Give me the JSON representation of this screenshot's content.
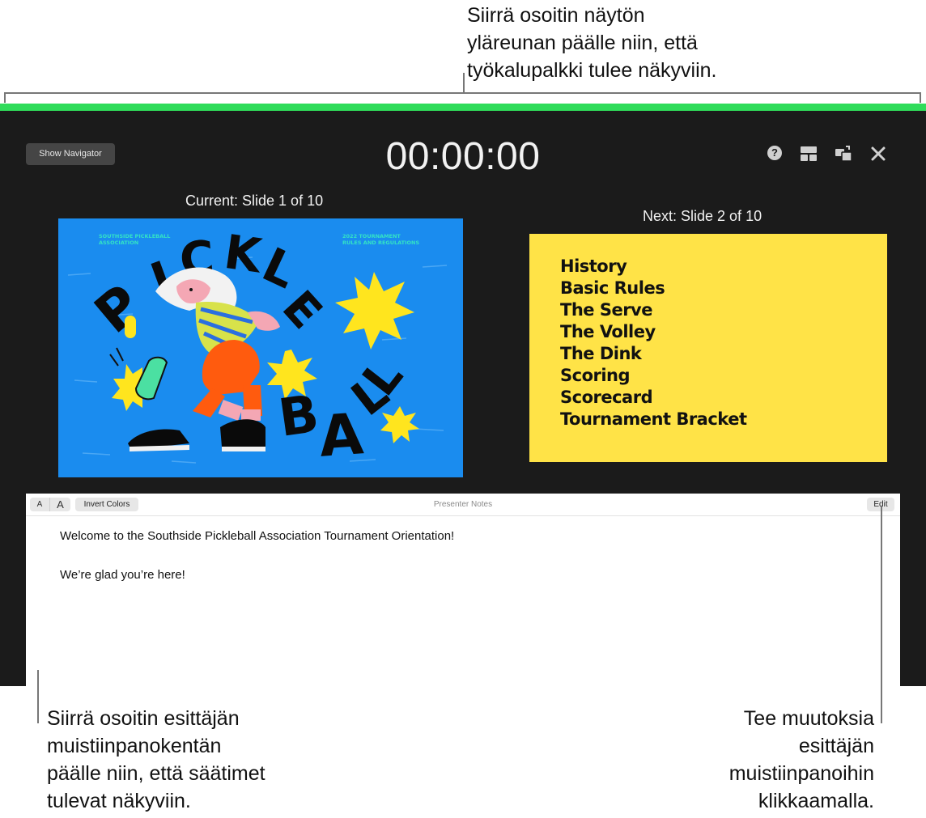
{
  "callouts": {
    "top": [
      "Siirrä osoitin näytön",
      "yläreunan päälle niin, että",
      "työkalupalkki tulee näkyviin."
    ],
    "left": [
      "Siirrä osoitin esittäjän",
      "muistiinpanokentän",
      "päälle niin, että säätimet",
      "tulevat näkyviin."
    ],
    "right": [
      "Tee muutoksia",
      "esittäjän",
      "muistiinpanoihin",
      "klikkaamalla."
    ]
  },
  "toolbar": {
    "show_navigator_label": "Show Navigator",
    "timer": "00:00:00",
    "help_glyph": "?",
    "icons": [
      "help-icon",
      "layout-icon",
      "swap-displays-icon",
      "close-icon"
    ]
  },
  "current_slide": {
    "label": "Current: Slide 1 of 10",
    "header_left": [
      "SOUTHSIDE PICKLEBALL",
      "ASSOCIATION"
    ],
    "header_right": [
      "2022 TOURNAMENT",
      "RULES AND REGULATIONS"
    ],
    "word1": [
      "P",
      "I",
      "C",
      "K",
      "L",
      "E"
    ],
    "word2": [
      "B",
      "A",
      "L",
      "L"
    ]
  },
  "next_slide": {
    "label": "Next: Slide 2 of 10",
    "items": [
      "History",
      "Basic Rules",
      "The Serve",
      "The Volley",
      "The Dink",
      "Scoring",
      "Scorecard",
      "Tournament Bracket"
    ]
  },
  "notes": {
    "font_smaller": "A",
    "font_larger": "A",
    "invert_colors": "Invert Colors",
    "title": "Presenter Notes",
    "edit": "Edit",
    "paragraphs": [
      "Welcome to the Southside Pickleball Association Tournament Orientation!",
      "We’re glad you’re here!"
    ]
  },
  "colors": {
    "accent_green": "#2fdc5a",
    "screen_bg": "#1b1b1b",
    "slide1_bg": "#1a8cef",
    "slide2_bg": "#ffe347"
  }
}
